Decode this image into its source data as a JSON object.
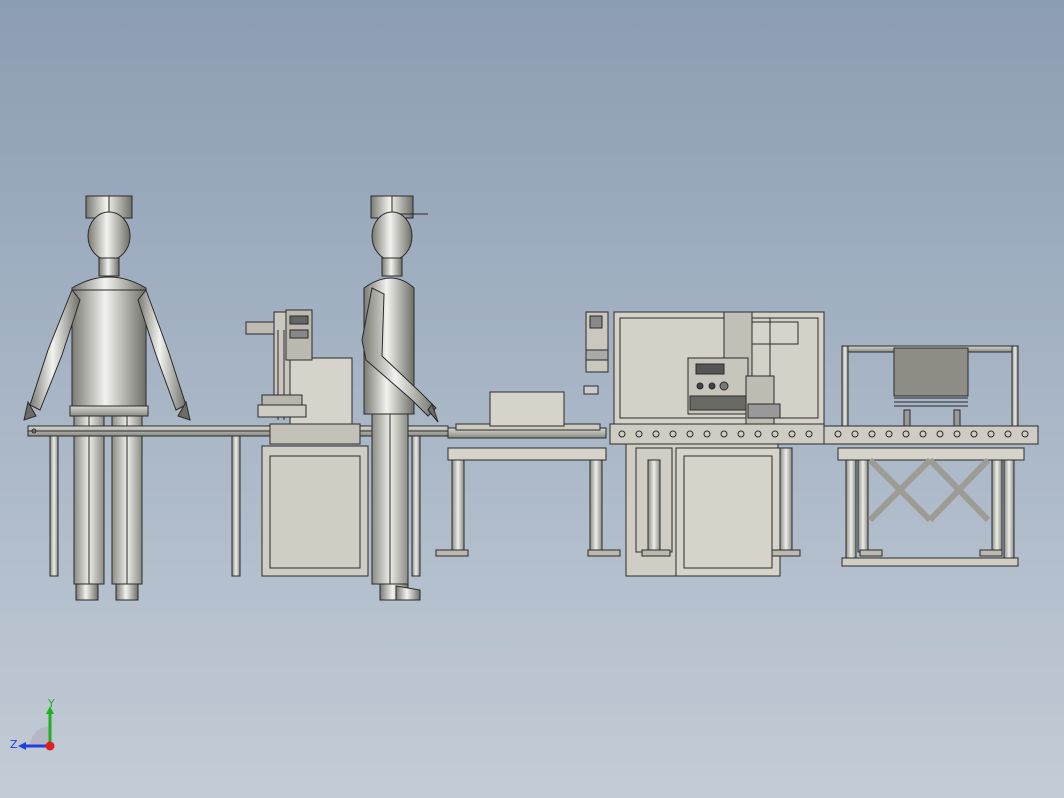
{
  "viewport": {
    "background_top": "#8b9db3",
    "background_bottom": "#c3ccd6",
    "line_color": "#2a2a2a",
    "metal_light": "#e8e8e4",
    "metal_dark": "#6c6c66",
    "panel_fill": "#d4d2c8"
  },
  "triad": {
    "y_label": "Y",
    "z_label": "Z",
    "x_color": "#e02020",
    "y_color": "#20b020",
    "z_color": "#2040e0"
  }
}
